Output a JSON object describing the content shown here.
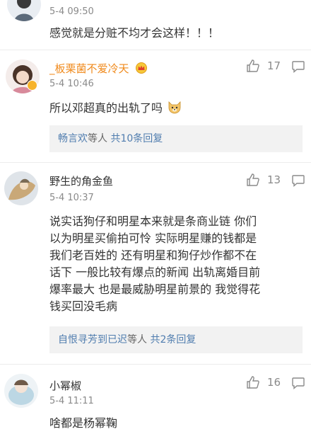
{
  "comments": [
    {
      "time": "5-4 09:50",
      "text": "感觉就是分赃不均才会这样！！！"
    },
    {
      "username": "_板栗菌不爱冷天",
      "time": "5-4 10:46",
      "likes": "17",
      "text": "所以邓超真的出轨了吗",
      "reply_users": "畅言欢",
      "reply_suffix": "等人 ",
      "reply_count": "共10条回复"
    },
    {
      "username": "野生的角金鱼",
      "time": "5-4 10:37",
      "likes": "13",
      "text_lines": [
        "说实话狗仔和明星本来就是条商业链 你们",
        "以为明星买偷拍可怜 实际明星赚的钱都是",
        "我们老百姓的 还有明星和狗仔炒作都不在",
        "话下 一般比较有爆点的新闻 出轨离婚目前",
        "爆率最大 也是最威胁明星前景的 我觉得花",
        "钱买回没毛病"
      ],
      "reply_users": "自恨寻芳到已迟",
      "reply_suffix": "等人 ",
      "reply_count": "共2条回复"
    },
    {
      "username": "小幂椒",
      "time": "5-4 11:11",
      "likes": "16",
      "text": "啥都是杨幂鞠"
    }
  ],
  "icons": {
    "like": "thumbs-up-icon",
    "comment": "speech-bubble-icon",
    "vip": "crown-icon",
    "verified": "verified-badge-icon",
    "emoji": "doge-emoji-icon"
  }
}
